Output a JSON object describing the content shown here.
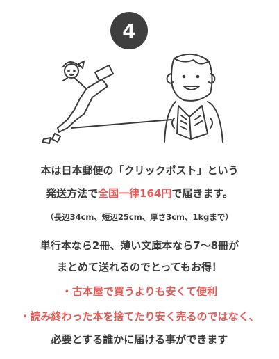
{
  "step": {
    "number": "4"
  },
  "colors": {
    "badge": "#3f3f3f",
    "accent": "#e05a57",
    "text": "#3a3a3a"
  },
  "icons": [
    "japan-map-icon",
    "girl-face-icon",
    "man-reading-book-icon",
    "envelope-icon"
  ],
  "lines": {
    "l1": "本は日本郵便の「クリックポスト」という",
    "l2_pre": "発送方法で",
    "l2_highlight": "全国一律164円",
    "l2_post": "で届きます。",
    "l3": "（長辺34cm、短辺25cm、厚さ3cm、1kgまで）",
    "l4": "単行本なら2冊、薄い文庫本なら7〜8冊が",
    "l5": "まとめて送れるのでとってもお得！",
    "l6": "・古本屋で買うよりも安くて便利",
    "l7": "・読み終わった本を捨てたり安く売るのではなく、",
    "l8": "必要とする誰かに届ける事ができます"
  }
}
